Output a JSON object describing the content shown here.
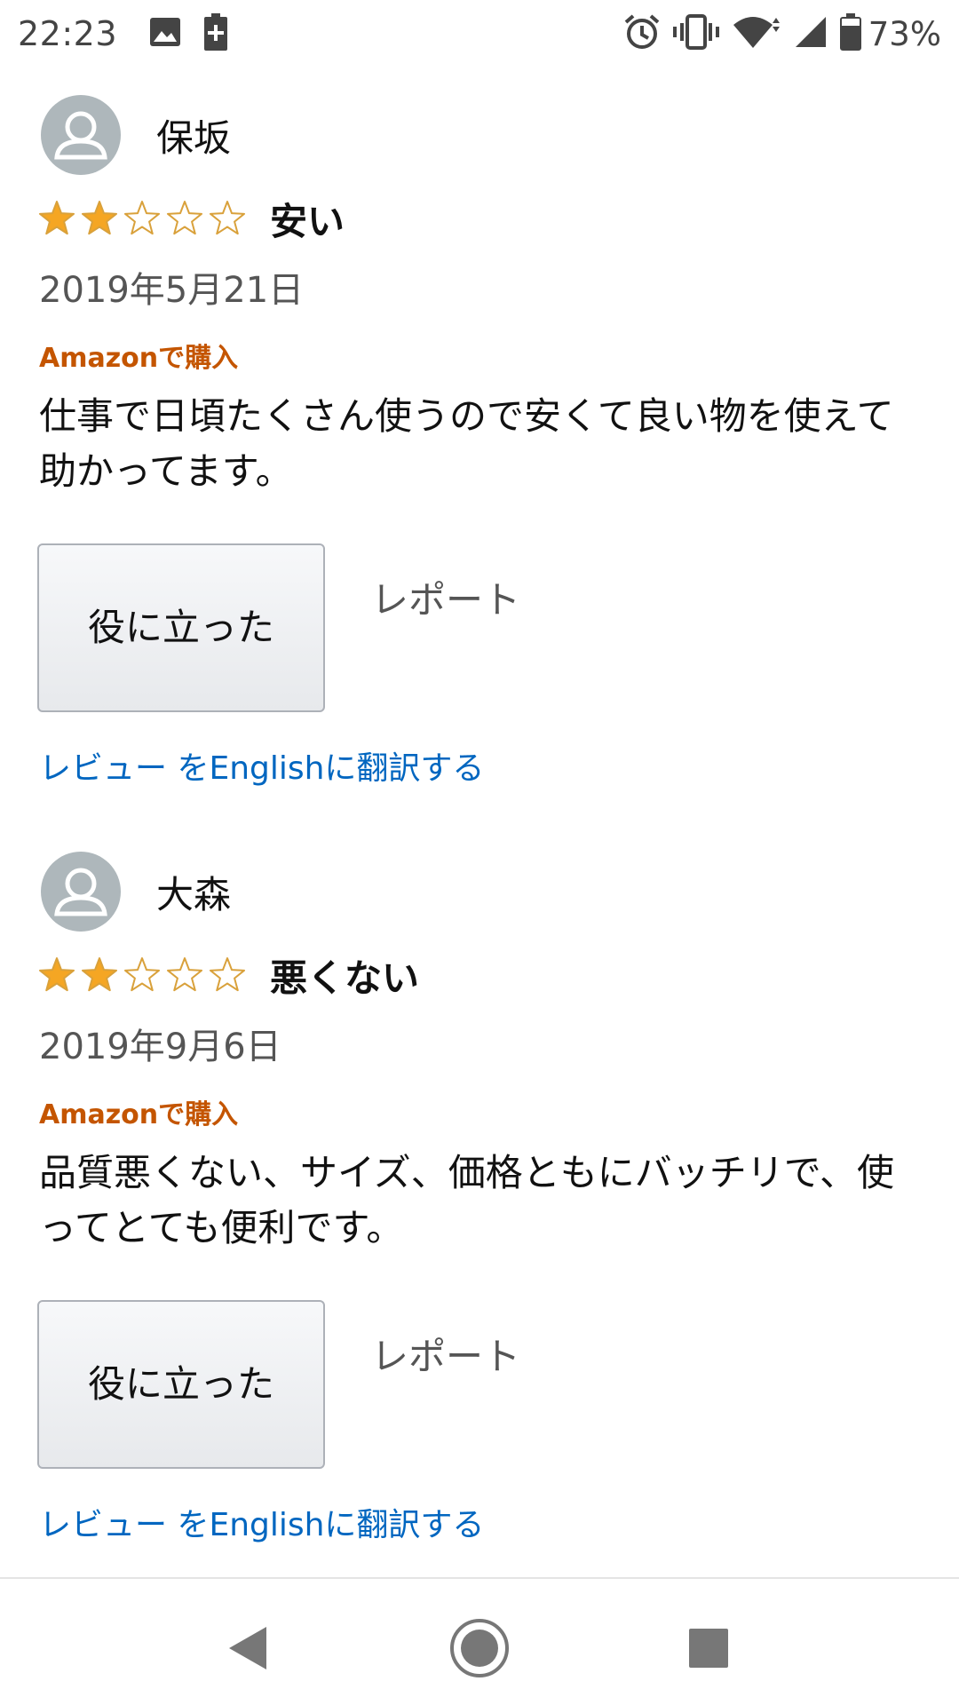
{
  "status_bar": {
    "time": "22:23",
    "battery_percent": "73%",
    "left_icons": [
      "image-icon",
      "battery-saver-icon"
    ],
    "right_icons": [
      "alarm-icon",
      "vibrate-icon",
      "wifi-icon",
      "signal-icon",
      "battery-icon"
    ]
  },
  "colors": {
    "star_filled": "#f5a623",
    "star_outline": "#d9a13b",
    "verified": "#c45500",
    "link": "#0066c0",
    "avatar": "#aeb7bb"
  },
  "reviews": [
    {
      "reviewer": "保坂",
      "rating": 2,
      "rating_max": 5,
      "title": "安い",
      "date": "2019年5月21日",
      "verified_label": "Amazonで購入",
      "body": "仕事で日頃たくさん使うので安くて良い物を使えて助かってます。",
      "helpful_label": "役に立った",
      "report_label": "レポート",
      "translate_label": "レビュー をEnglishに翻訳する"
    },
    {
      "reviewer": "大森",
      "rating": 2,
      "rating_max": 5,
      "title": "悪くない",
      "date": "2019年9月6日",
      "verified_label": "Amazonで購入",
      "body": "品質悪くない、サイズ、価格ともにバッチリで、使ってとても便利です。",
      "helpful_label": "役に立った",
      "report_label": "レポート",
      "translate_label": "レビュー をEnglishに翻訳する"
    }
  ],
  "nav_bar": {
    "icons": [
      "back-icon",
      "home-icon",
      "recents-icon"
    ]
  }
}
